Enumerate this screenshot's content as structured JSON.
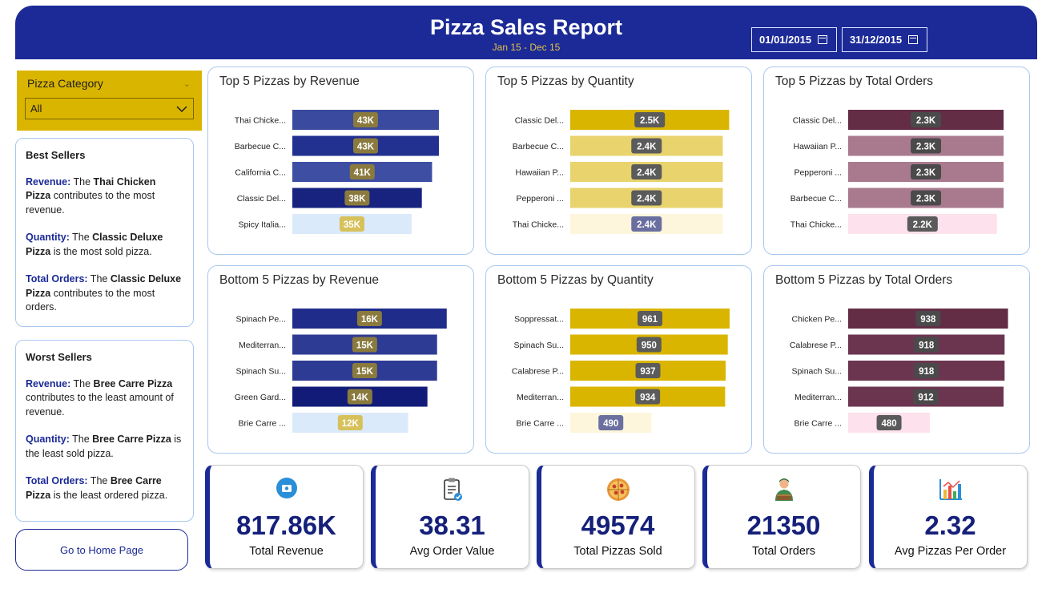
{
  "header": {
    "title": "Pizza Sales Report",
    "subtitle": "Jan 15 - Dec 15",
    "start_date": "01/01/2015",
    "end_date": "31/12/2015"
  },
  "slicer": {
    "label": "Pizza Category",
    "value": "All"
  },
  "best": {
    "title": "Best Sellers",
    "revenue": {
      "k": "Revenue:",
      "a": " The ",
      "b": "Thai Chicken Pizza",
      "c": " contributes to the most revenue."
    },
    "quantity": {
      "k": "Quantity:",
      "a": " The ",
      "b": "Classic Deluxe Pizza",
      "c": " is the most sold pizza."
    },
    "orders": {
      "k": "Total Orders:",
      "a": " The ",
      "b": "Classic Deluxe Pizza",
      "c": " contributes to the most orders."
    }
  },
  "worst": {
    "title": "Worst Sellers",
    "revenue": {
      "k": "Revenue:",
      "a": " The ",
      "b": "Bree Carre Pizza",
      "c": " contributes to the least amount of revenue."
    },
    "quantity": {
      "k": "Quantity:",
      "a": " The ",
      "b": "Bree Carre Pizza",
      "c": " is the least sold pizza."
    },
    "orders": {
      "k": "Total Orders:",
      "a": " The ",
      "b": "Bree Carre Pizza",
      "c": " is the least ordered pizza."
    }
  },
  "home_button": "Go to Home Page",
  "kpis": [
    {
      "value": "817.86K",
      "label": "Total Revenue",
      "icon": "money-icon"
    },
    {
      "value": "38.31",
      "label": "Avg Order Value",
      "icon": "clipboard-icon"
    },
    {
      "value": "49574",
      "label": "Total Pizzas Sold",
      "icon": "pizza-icon"
    },
    {
      "value": "21350",
      "label": "Total Orders",
      "icon": "delivery-person-icon"
    },
    {
      "value": "2.32",
      "label": "Avg Pizzas Per Order",
      "icon": "bar-chart-icon"
    }
  ],
  "colors": {
    "header": "#1b2a96",
    "accent": "#dab500",
    "maroon": "#632d45"
  },
  "chart_data": [
    {
      "type": "bar",
      "title": "Top 5 Pizzas by Revenue",
      "categories": [
        "Thai Chicke...",
        "Barbecue C...",
        "California C...",
        "Classic Del...",
        "Spicy Italia..."
      ],
      "values": [
        43,
        43,
        41,
        38,
        35
      ],
      "labels": [
        "43K",
        "43K",
        "41K",
        "38K",
        "35K"
      ],
      "colors": [
        "#3a4a9e",
        "#22308f",
        "#3d4ea3",
        "#17237f",
        "#dbeafb"
      ],
      "label_bg": [
        "#8a7a3e",
        "#8a7a3e",
        "#8a7a3e",
        "#8a7a3e",
        "#d6c15a"
      ],
      "xlim": [
        0,
        47
      ]
    },
    {
      "type": "bar",
      "title": "Top 5 Pizzas by Quantity",
      "categories": [
        "Classic Del...",
        "Barbecue C...",
        "Hawaiian P...",
        "Pepperoni ...",
        "Thai Chicke..."
      ],
      "values": [
        2.5,
        2.4,
        2.4,
        2.4,
        2.4
      ],
      "labels": [
        "2.5K",
        "2.4K",
        "2.4K",
        "2.4K",
        "2.4K"
      ],
      "colors": [
        "#dab500",
        "#e8d36d",
        "#e8d36d",
        "#e8d36d",
        "#fdf6dc"
      ],
      "label_bg": [
        "#5b5b5b",
        "#5b5b5b",
        "#5b5b5b",
        "#5b5b5b",
        "#6a6fa0"
      ],
      "xlim": [
        0,
        2.52
      ]
    },
    {
      "type": "bar",
      "title": "Top 5 Pizzas by Total Orders",
      "categories": [
        "Classic Del...",
        "Hawaiian P...",
        "Pepperoni ...",
        "Barbecue C...",
        "Thai Chicke..."
      ],
      "values": [
        2.3,
        2.3,
        2.3,
        2.3,
        2.2
      ],
      "labels": [
        "2.3K",
        "2.3K",
        "2.3K",
        "2.3K",
        "2.2K"
      ],
      "colors": [
        "#632d45",
        "#a97a8e",
        "#a97a8e",
        "#a97a8e",
        "#fde1ec"
      ],
      "label_bg": [
        "#4a4a4a",
        "#4a4a4a",
        "#4a4a4a",
        "#4a4a4a",
        "#5a5a5a"
      ],
      "xlim": [
        0,
        2.37
      ]
    },
    {
      "type": "bar",
      "title": "Bottom 5 Pizzas by Revenue",
      "categories": [
        "Spinach Pe...",
        "Mediterran...",
        "Spinach Su...",
        "Green Gard...",
        "Brie Carre ..."
      ],
      "values": [
        16,
        15,
        15,
        14,
        12
      ],
      "labels": [
        "16K",
        "15K",
        "15K",
        "14K",
        "12K"
      ],
      "colors": [
        "#1f2c8a",
        "#2e3b94",
        "#2e3b94",
        "#121c78",
        "#dbeafb"
      ],
      "label_bg": [
        "#8a7a3e",
        "#8a7a3e",
        "#8a7a3e",
        "#8a7a3e",
        "#d6c15a"
      ],
      "xlim": [
        0,
        16.6
      ]
    },
    {
      "type": "bar",
      "title": "Bottom 5 Pizzas by Quantity",
      "categories": [
        "Soppressat...",
        "Spinach Su...",
        "Calabrese P...",
        "Mediterran...",
        "Brie Carre ..."
      ],
      "values": [
        961,
        950,
        937,
        934,
        490
      ],
      "labels": [
        "961",
        "950",
        "937",
        "934",
        "490"
      ],
      "colors": [
        "#dab500",
        "#dab500",
        "#dab500",
        "#dab500",
        "#fdf6dc"
      ],
      "label_bg": [
        "#5b5b5b",
        "#5b5b5b",
        "#5b5b5b",
        "#5b5b5b",
        "#6a6fa0"
      ],
      "xlim": [
        0,
        966
      ]
    },
    {
      "type": "bar",
      "title": "Bottom 5 Pizzas by Total Orders",
      "categories": [
        "Chicken Pe...",
        "Calabrese P...",
        "Spinach Su...",
        "Mediterran...",
        "Brie Carre ..."
      ],
      "values": [
        938,
        918,
        918,
        912,
        480
      ],
      "labels": [
        "938",
        "918",
        "918",
        "912",
        "480"
      ],
      "colors": [
        "#632d45",
        "#6b3550",
        "#6b3550",
        "#6b3550",
        "#fde1ec"
      ],
      "label_bg": [
        "#4a4a4a",
        "#4a4a4a",
        "#4a4a4a",
        "#4a4a4a",
        "#5a5a5a"
      ],
      "xlim": [
        0,
        940
      ]
    }
  ]
}
